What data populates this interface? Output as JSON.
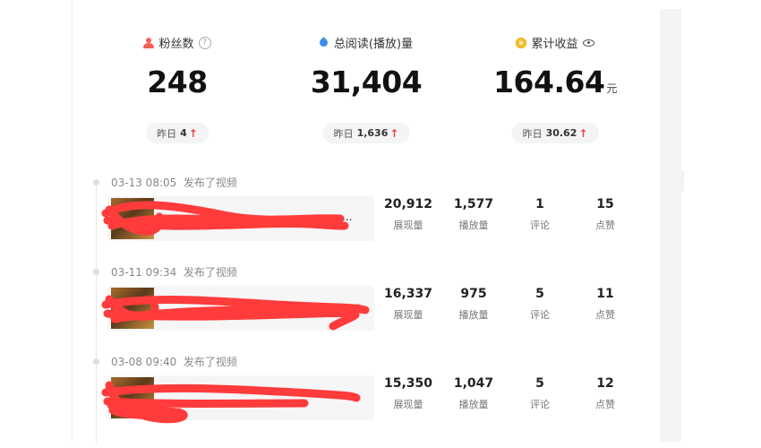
{
  "stats": [
    {
      "label": "粉丝数",
      "value": "248",
      "unit": "",
      "yesterday_label": "昨日",
      "yesterday_value": "4"
    },
    {
      "label": "总阅读(播放)量",
      "value": "31,404",
      "unit": "",
      "yesterday_label": "昨日",
      "yesterday_value": "1,636"
    },
    {
      "label": "累计收益",
      "value": "164.64",
      "unit": "元",
      "yesterday_label": "昨日",
      "yesterday_value": "30.62"
    }
  ],
  "trend_arrow": "↑",
  "help_glyph": "?",
  "metric_labels": {
    "impressions": "展现量",
    "plays": "播放量",
    "comments": "评论",
    "likes": "点赞"
  },
  "posts": [
    {
      "time": "03-13 08:05",
      "action": "发布了视频",
      "title_visible": "...",
      "impressions": "20,912",
      "plays": "1,577",
      "comments": "1",
      "likes": "15"
    },
    {
      "time": "03-11 09:34",
      "action": "发布了视频",
      "title_visible": "",
      "impressions": "16,337",
      "plays": "975",
      "comments": "5",
      "likes": "11"
    },
    {
      "time": "03-08 09:40",
      "action": "发布了视频",
      "title_visible": "...",
      "impressions": "15,350",
      "plays": "1,047",
      "comments": "5",
      "likes": "12"
    }
  ],
  "colors": {
    "accent_red": "#e8453c",
    "redaction": "#ff3b3b",
    "fans_icon": "#f06158",
    "views_icon": "#3d8bf0",
    "income_icon": "#f5c02a"
  },
  "icons": [
    "person-icon",
    "help-icon",
    "drop-icon",
    "coin-icon",
    "eye-icon"
  ]
}
